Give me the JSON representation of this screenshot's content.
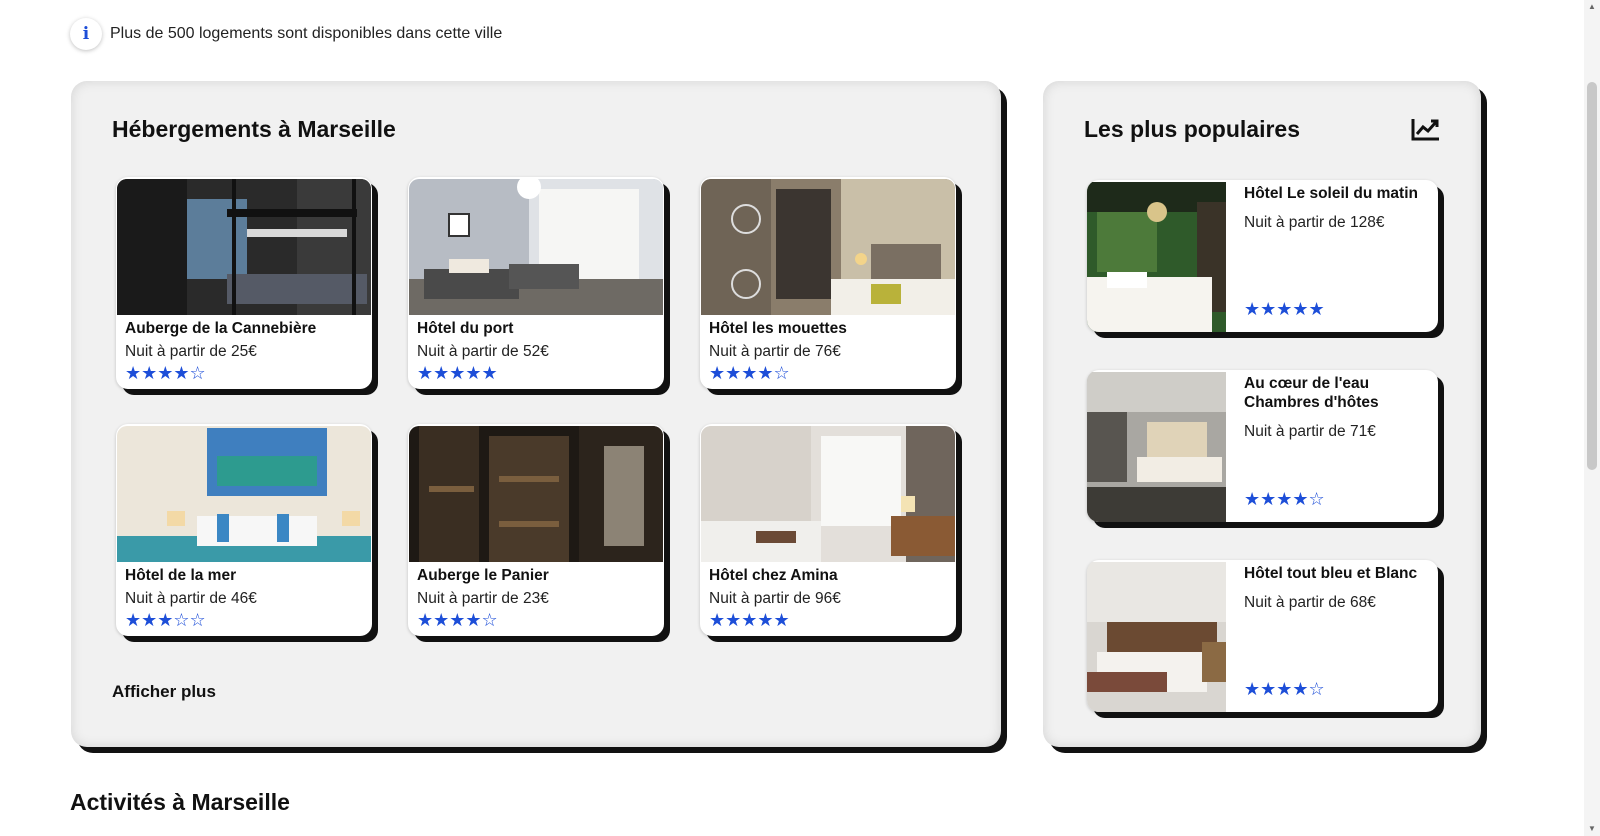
{
  "info": {
    "text": "Plus de 500 logements sont disponibles dans cette ville"
  },
  "main": {
    "title": "Hébergements à Marseille",
    "show_more": "Afficher plus",
    "cards": [
      {
        "name": "Auberge de la Cannebière",
        "price": "Nuit à partir de 25€",
        "rating": 4,
        "stars": "★★★★☆"
      },
      {
        "name": "Hôtel du port",
        "price": "Nuit à partir de 52€",
        "rating": 5,
        "stars": "★★★★★"
      },
      {
        "name": "Hôtel les mouettes",
        "price": "Nuit à partir de 76€",
        "rating": 4,
        "stars": "★★★★☆"
      },
      {
        "name": "Hôtel de la mer",
        "price": "Nuit à partir de 46€",
        "rating": 3,
        "stars": "★★★☆☆"
      },
      {
        "name": "Auberge le Panier",
        "price": "Nuit à partir de 23€",
        "rating": 4,
        "stars": "★★★★☆"
      },
      {
        "name": "Hôtel chez Amina",
        "price": "Nuit à partir de 96€",
        "rating": 5,
        "stars": "★★★★★"
      }
    ]
  },
  "popular": {
    "title": "Les plus populaires",
    "icon": "trend-chart-icon",
    "items": [
      {
        "name": "Hôtel Le soleil du matin",
        "price": "Nuit à partir de 128€",
        "rating": 5,
        "stars": "★★★★★"
      },
      {
        "name": "Au cœur de l'eau Chambres d'hôtes",
        "price": "Nuit à partir de 71€",
        "rating": 4,
        "stars": "★★★★☆"
      },
      {
        "name": "Hôtel tout bleu et Blanc",
        "price": "Nuit à partir de 68€",
        "rating": 4,
        "stars": "★★★★☆"
      }
    ]
  },
  "activities": {
    "title": "Activités à Marseille"
  },
  "colors": {
    "accent": "#1d4ed8",
    "panel": "#f1f1f1",
    "shadow": "#111111"
  }
}
